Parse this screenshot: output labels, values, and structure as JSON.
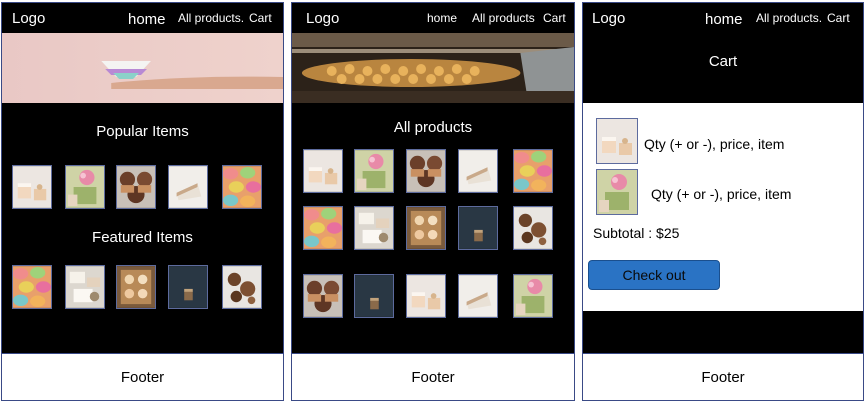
{
  "nav": {
    "logo": "Logo",
    "home": "home",
    "all_products": "All products.",
    "all_products_plain": "All products",
    "cart": "Cart"
  },
  "home_page": {
    "popular_heading": "Popular Items",
    "featured_heading": "Featured Items",
    "footer": "Footer"
  },
  "products_page": {
    "heading": "All products",
    "footer": "Footer"
  },
  "cart_page": {
    "heading": "Cart",
    "items": [
      {
        "text": "Qty (+ or -), price, item"
      },
      {
        "text": "Qty (+ or -), price, item"
      }
    ],
    "subtotal": "Subtotal : $25",
    "checkout": "Check out",
    "footer": "Footer"
  },
  "colors": {
    "accent": "#2a73c4",
    "background": "#000000",
    "border": "#3a4a86"
  }
}
